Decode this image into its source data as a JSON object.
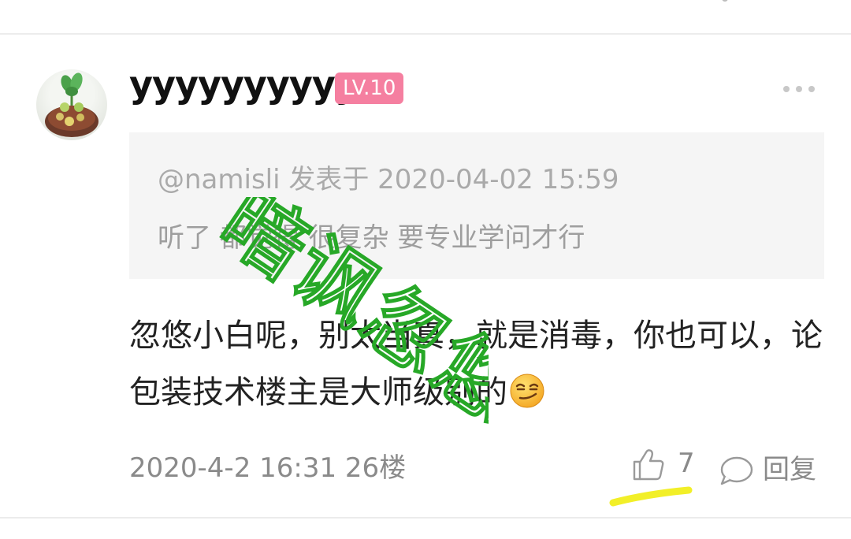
{
  "comment": {
    "username": "yyyyyyyyyy",
    "level": "LV.10",
    "quote": {
      "meta": "@namisli 发表于 2020-04-02 15:59",
      "text": "听了 都觉得 很复杂 要专业学问才行"
    },
    "text": "忽悠小白呢，别太当真，就是消毒，你也可以，论包装技术楼主是大师级别的",
    "emoji_icon": "smirk-emoji-icon",
    "footer_meta": "2020-4-2 16:31  26楼",
    "like_count": "7",
    "reply_label": "回复"
  },
  "overlay": {
    "watermark_text": "暗讽忽悠",
    "watermark_color": "#27a827",
    "highlight_color": "#f2ef28"
  },
  "icons": [
    "avatar-plant",
    "more-icon",
    "thumbs-up-icon",
    "speech-bubble-icon",
    "smirk-emoji-icon"
  ]
}
